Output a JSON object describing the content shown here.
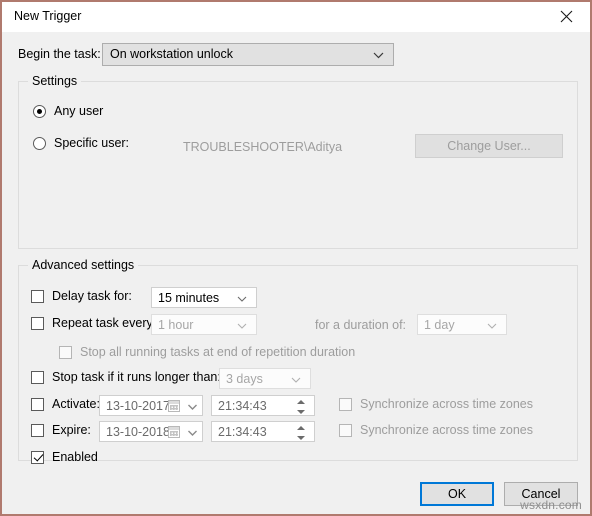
{
  "window": {
    "title": "New Trigger",
    "close_icon": "close-icon",
    "border_color": "#b07a6e"
  },
  "begin": {
    "label": "Begin the task:",
    "value": "On workstation unlock"
  },
  "settings": {
    "legend": "Settings",
    "any_user": {
      "label": "Any user",
      "checked": true
    },
    "specific_user": {
      "label": "Specific user:",
      "checked": false
    },
    "user_value": "TROUBLESHOOTER\\Aditya",
    "change_user_button": "Change User..."
  },
  "advanced": {
    "legend": "Advanced settings",
    "delay_task": {
      "label": "Delay task for:",
      "checked": false,
      "value": "15 minutes"
    },
    "repeat_task": {
      "label": "Repeat task every:",
      "checked": false,
      "value": "1 hour"
    },
    "duration": {
      "label": "for a duration of:",
      "value": "1 day"
    },
    "stop_all": {
      "label": "Stop all running tasks at end of repetition duration",
      "checked": false
    },
    "stop_task": {
      "label": "Stop task if it runs longer than:",
      "checked": false,
      "value": "3 days"
    },
    "activate": {
      "label": "Activate:",
      "checked": false,
      "date": "13-10-2017",
      "time": "21:34:43",
      "sync_label": "Synchronize across time zones",
      "sync_checked": false
    },
    "expire": {
      "label": "Expire:",
      "checked": false,
      "date": "13-10-2018",
      "time": "21:34:43",
      "sync_label": "Synchronize across time zones",
      "sync_checked": false
    },
    "enabled": {
      "label": "Enabled",
      "checked": true
    }
  },
  "footer": {
    "ok": "OK",
    "cancel": "Cancel",
    "accent_color": "#0078d7"
  },
  "watermark": "wsxdn.com"
}
